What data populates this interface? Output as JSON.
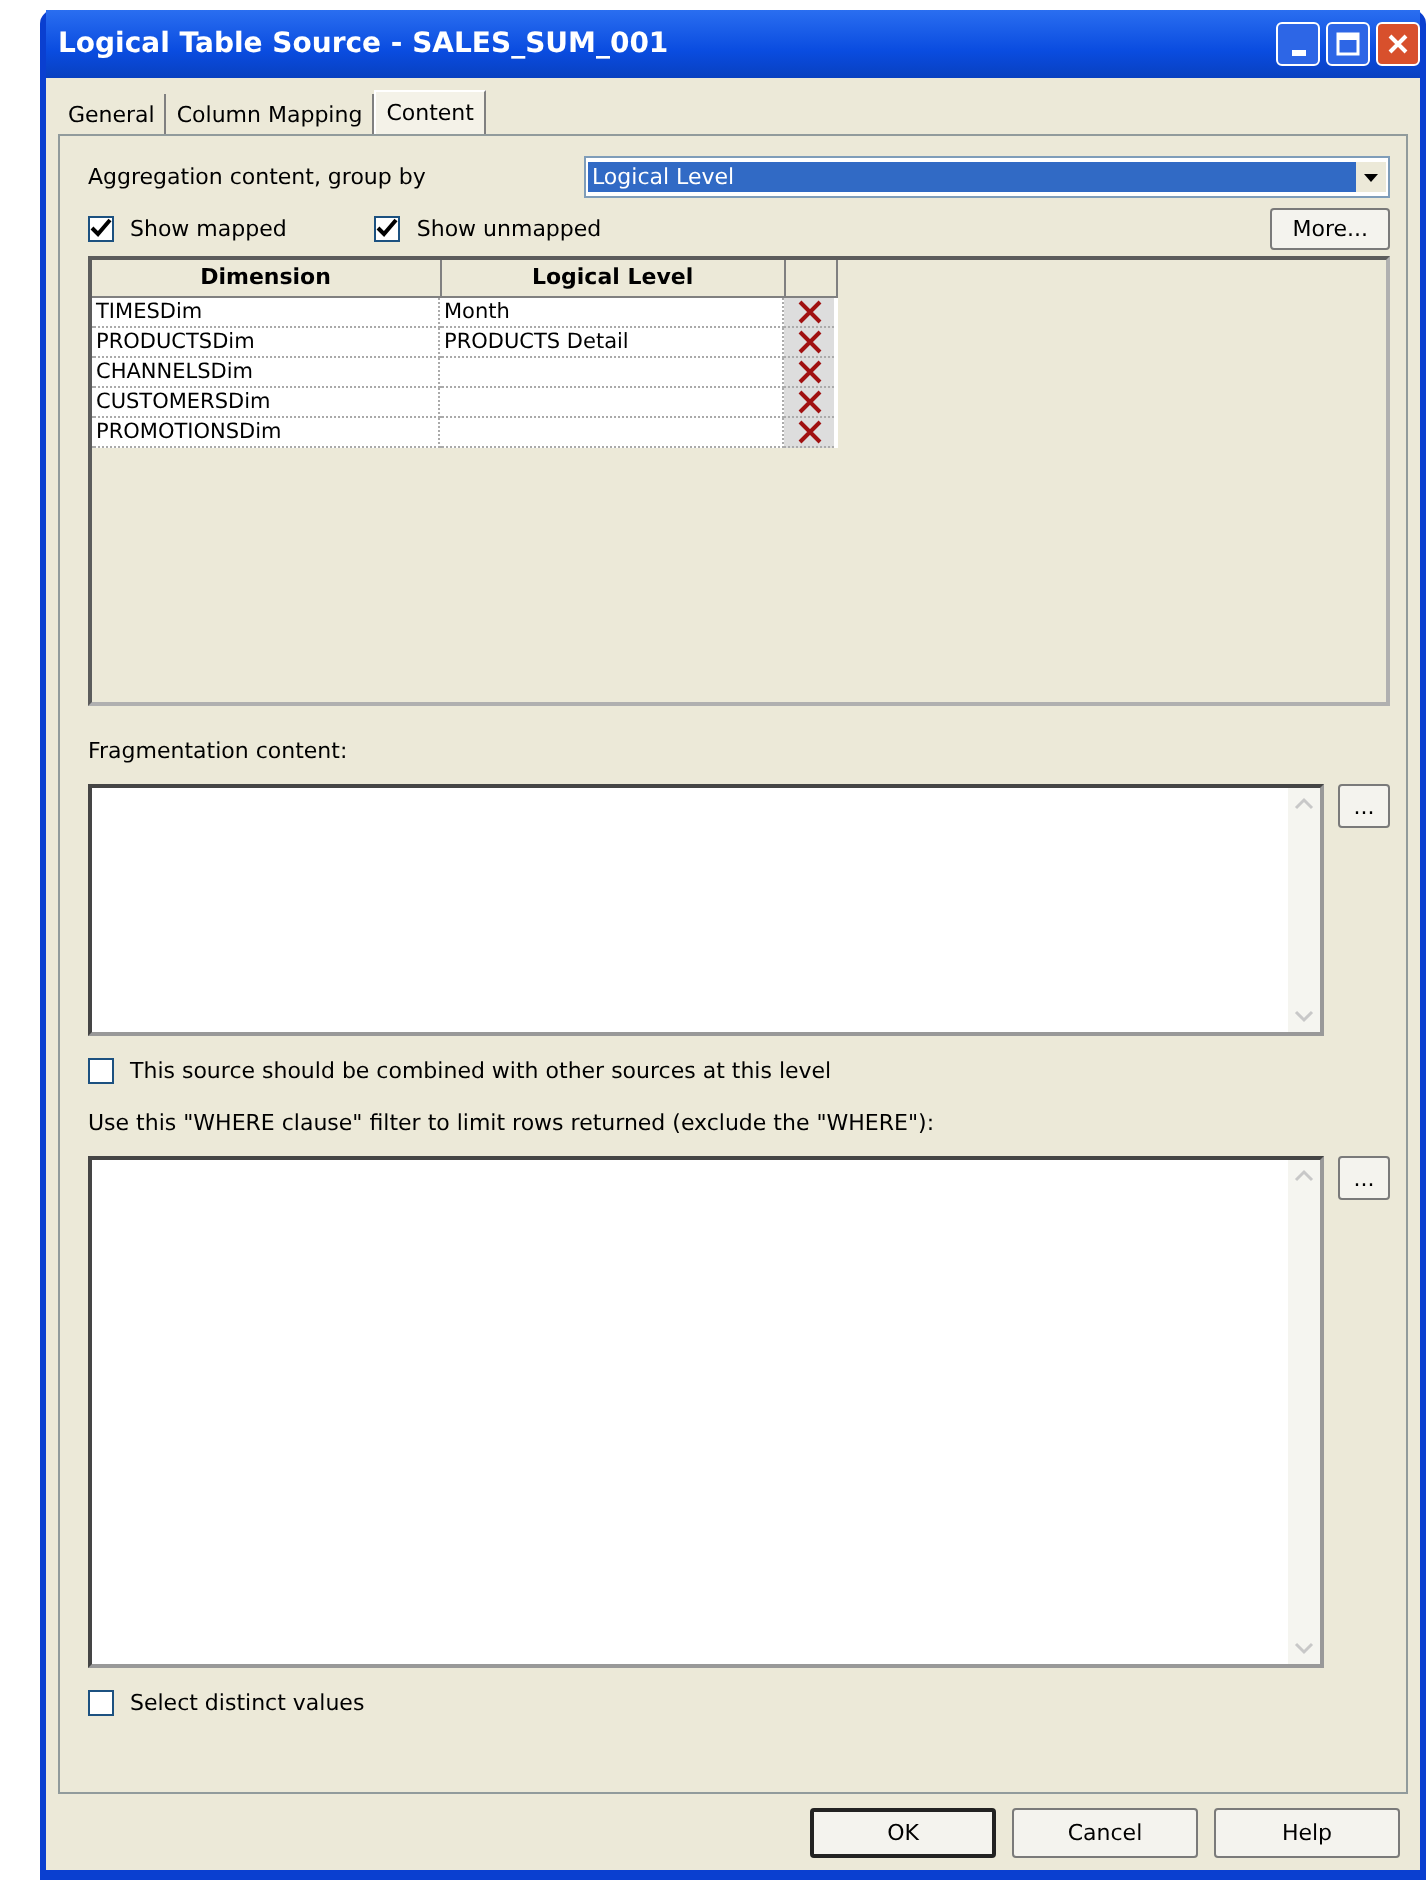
{
  "window": {
    "title": "Logical Table Source - SALES_SUM_001"
  },
  "tabs": [
    {
      "label": "General",
      "selected": false
    },
    {
      "label": "Column Mapping",
      "selected": false
    },
    {
      "label": "Content",
      "selected": true
    }
  ],
  "aggregation": {
    "label": "Aggregation content, group by",
    "value": "Logical Level"
  },
  "show_mapped": {
    "label": "Show mapped",
    "checked": true
  },
  "show_unmapped": {
    "label": "Show unmapped",
    "checked": true
  },
  "more_button": "More...",
  "table": {
    "columns": [
      "Dimension",
      "Logical Level"
    ],
    "rows": [
      {
        "dimension": "TIMESDim",
        "level": "Month"
      },
      {
        "dimension": "PRODUCTSDim",
        "level": "PRODUCTS Detail"
      },
      {
        "dimension": "CHANNELSDim",
        "level": ""
      },
      {
        "dimension": "CUSTOMERSDim",
        "level": ""
      },
      {
        "dimension": "PROMOTIONSDim",
        "level": ""
      }
    ]
  },
  "fragmentation": {
    "label": "Fragmentation content:",
    "button": "..."
  },
  "combine": {
    "label": "This source should be combined with other sources at this level",
    "checked": false
  },
  "where": {
    "label": "Use this \"WHERE clause\" filter to limit rows returned (exclude the \"WHERE\"):",
    "button": "..."
  },
  "distinct": {
    "label": "Select distinct values",
    "checked": false
  },
  "buttons": [
    "OK",
    "Cancel",
    "Help"
  ]
}
